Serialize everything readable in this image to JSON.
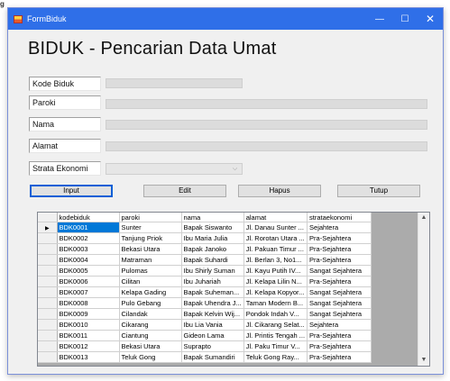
{
  "figure_label": "g",
  "window": {
    "title": "FormBiduk",
    "controls": {
      "minimize": "—",
      "maximize": "☐",
      "close": "✕"
    }
  },
  "heading": "BIDUK - Pencarian Data Umat",
  "fields": {
    "kode_biduk": {
      "label": "Kode Biduk",
      "value": ""
    },
    "paroki": {
      "label": "Paroki",
      "value": ""
    },
    "nama": {
      "label": "Nama",
      "value": ""
    },
    "alamat": {
      "label": "Alamat",
      "value": ""
    },
    "strata_ekonomi": {
      "label": "Strata Ekonomi",
      "value": ""
    }
  },
  "buttons": {
    "input": "Input",
    "edit": "Edit",
    "hapus": "Hapus",
    "tutup": "Tutup"
  },
  "grid": {
    "columns": [
      "kodebiduk",
      "paroki",
      "nama",
      "alamat",
      "strataekonomi"
    ],
    "rows": [
      [
        "BDK0001",
        "Sunter",
        "Bapak Siswanto",
        "Jl. Danau Sunter ...",
        "Sejahtera"
      ],
      [
        "BDK0002",
        "Tanjung Priok",
        "Ibu Maria Julia",
        "Jl. Rorotan Utara ...",
        "Pra-Sejahtera"
      ],
      [
        "BDK0003",
        "Bekasi Utara",
        "Bapak Janoko",
        "Jl. Pakuan Timur ...",
        "Pra-Sejahtera"
      ],
      [
        "BDK0004",
        "Matraman",
        "Bapak Suhardi",
        "Jl. Berlan 3, No1...",
        "Pra-Sejahtera"
      ],
      [
        "BDK0005",
        "Pulomas",
        "Ibu Shirly Suman",
        "Jl. Kayu Putih IV...",
        "Sangat Sejahtera"
      ],
      [
        "BDK0006",
        "Cilitan",
        "Ibu Juhariah",
        "Jl. Kelapa Lilin N...",
        "Pra-Sejahtera"
      ],
      [
        "BDK0007",
        "Kelapa Gading",
        "Bapak Suheman...",
        "Jl. Kelapa Kopyor...",
        "Sangat Sejahtera"
      ],
      [
        "BDK0008",
        "Pulo Gebang",
        "Bapak Uhendra J...",
        "Taman Modern B...",
        "Sangat Sejahtera"
      ],
      [
        "BDK0009",
        "Cilandak",
        "Bapak Kelvin Wij...",
        "Pondok Indah V...",
        "Sangat Sejahtera"
      ],
      [
        "BDK0010",
        "Cikarang",
        "Ibu Lia Vania",
        "Jl. Cikarang Selat...",
        "Sejahtera"
      ],
      [
        "BDK0011",
        "Ciantung",
        "Gideon Lama",
        "Jl. Printis Tengah ...",
        "Pra-Sejahtera"
      ],
      [
        "BDK0012",
        "Bekasi Utara",
        "Suprapto",
        "Jl. Paku Timur V...",
        "Pra-Sejahtera"
      ],
      [
        "BDK0013",
        "Teluk Gong",
        "Bapak Sumandiri",
        "Teluk Gong Ray...",
        "Pra-Sejahtera"
      ]
    ],
    "current_row_marker": "▶"
  },
  "colors": {
    "titlebar": "#2f6fe8",
    "selection": "#0078d7",
    "grid_background": "#ababab"
  }
}
